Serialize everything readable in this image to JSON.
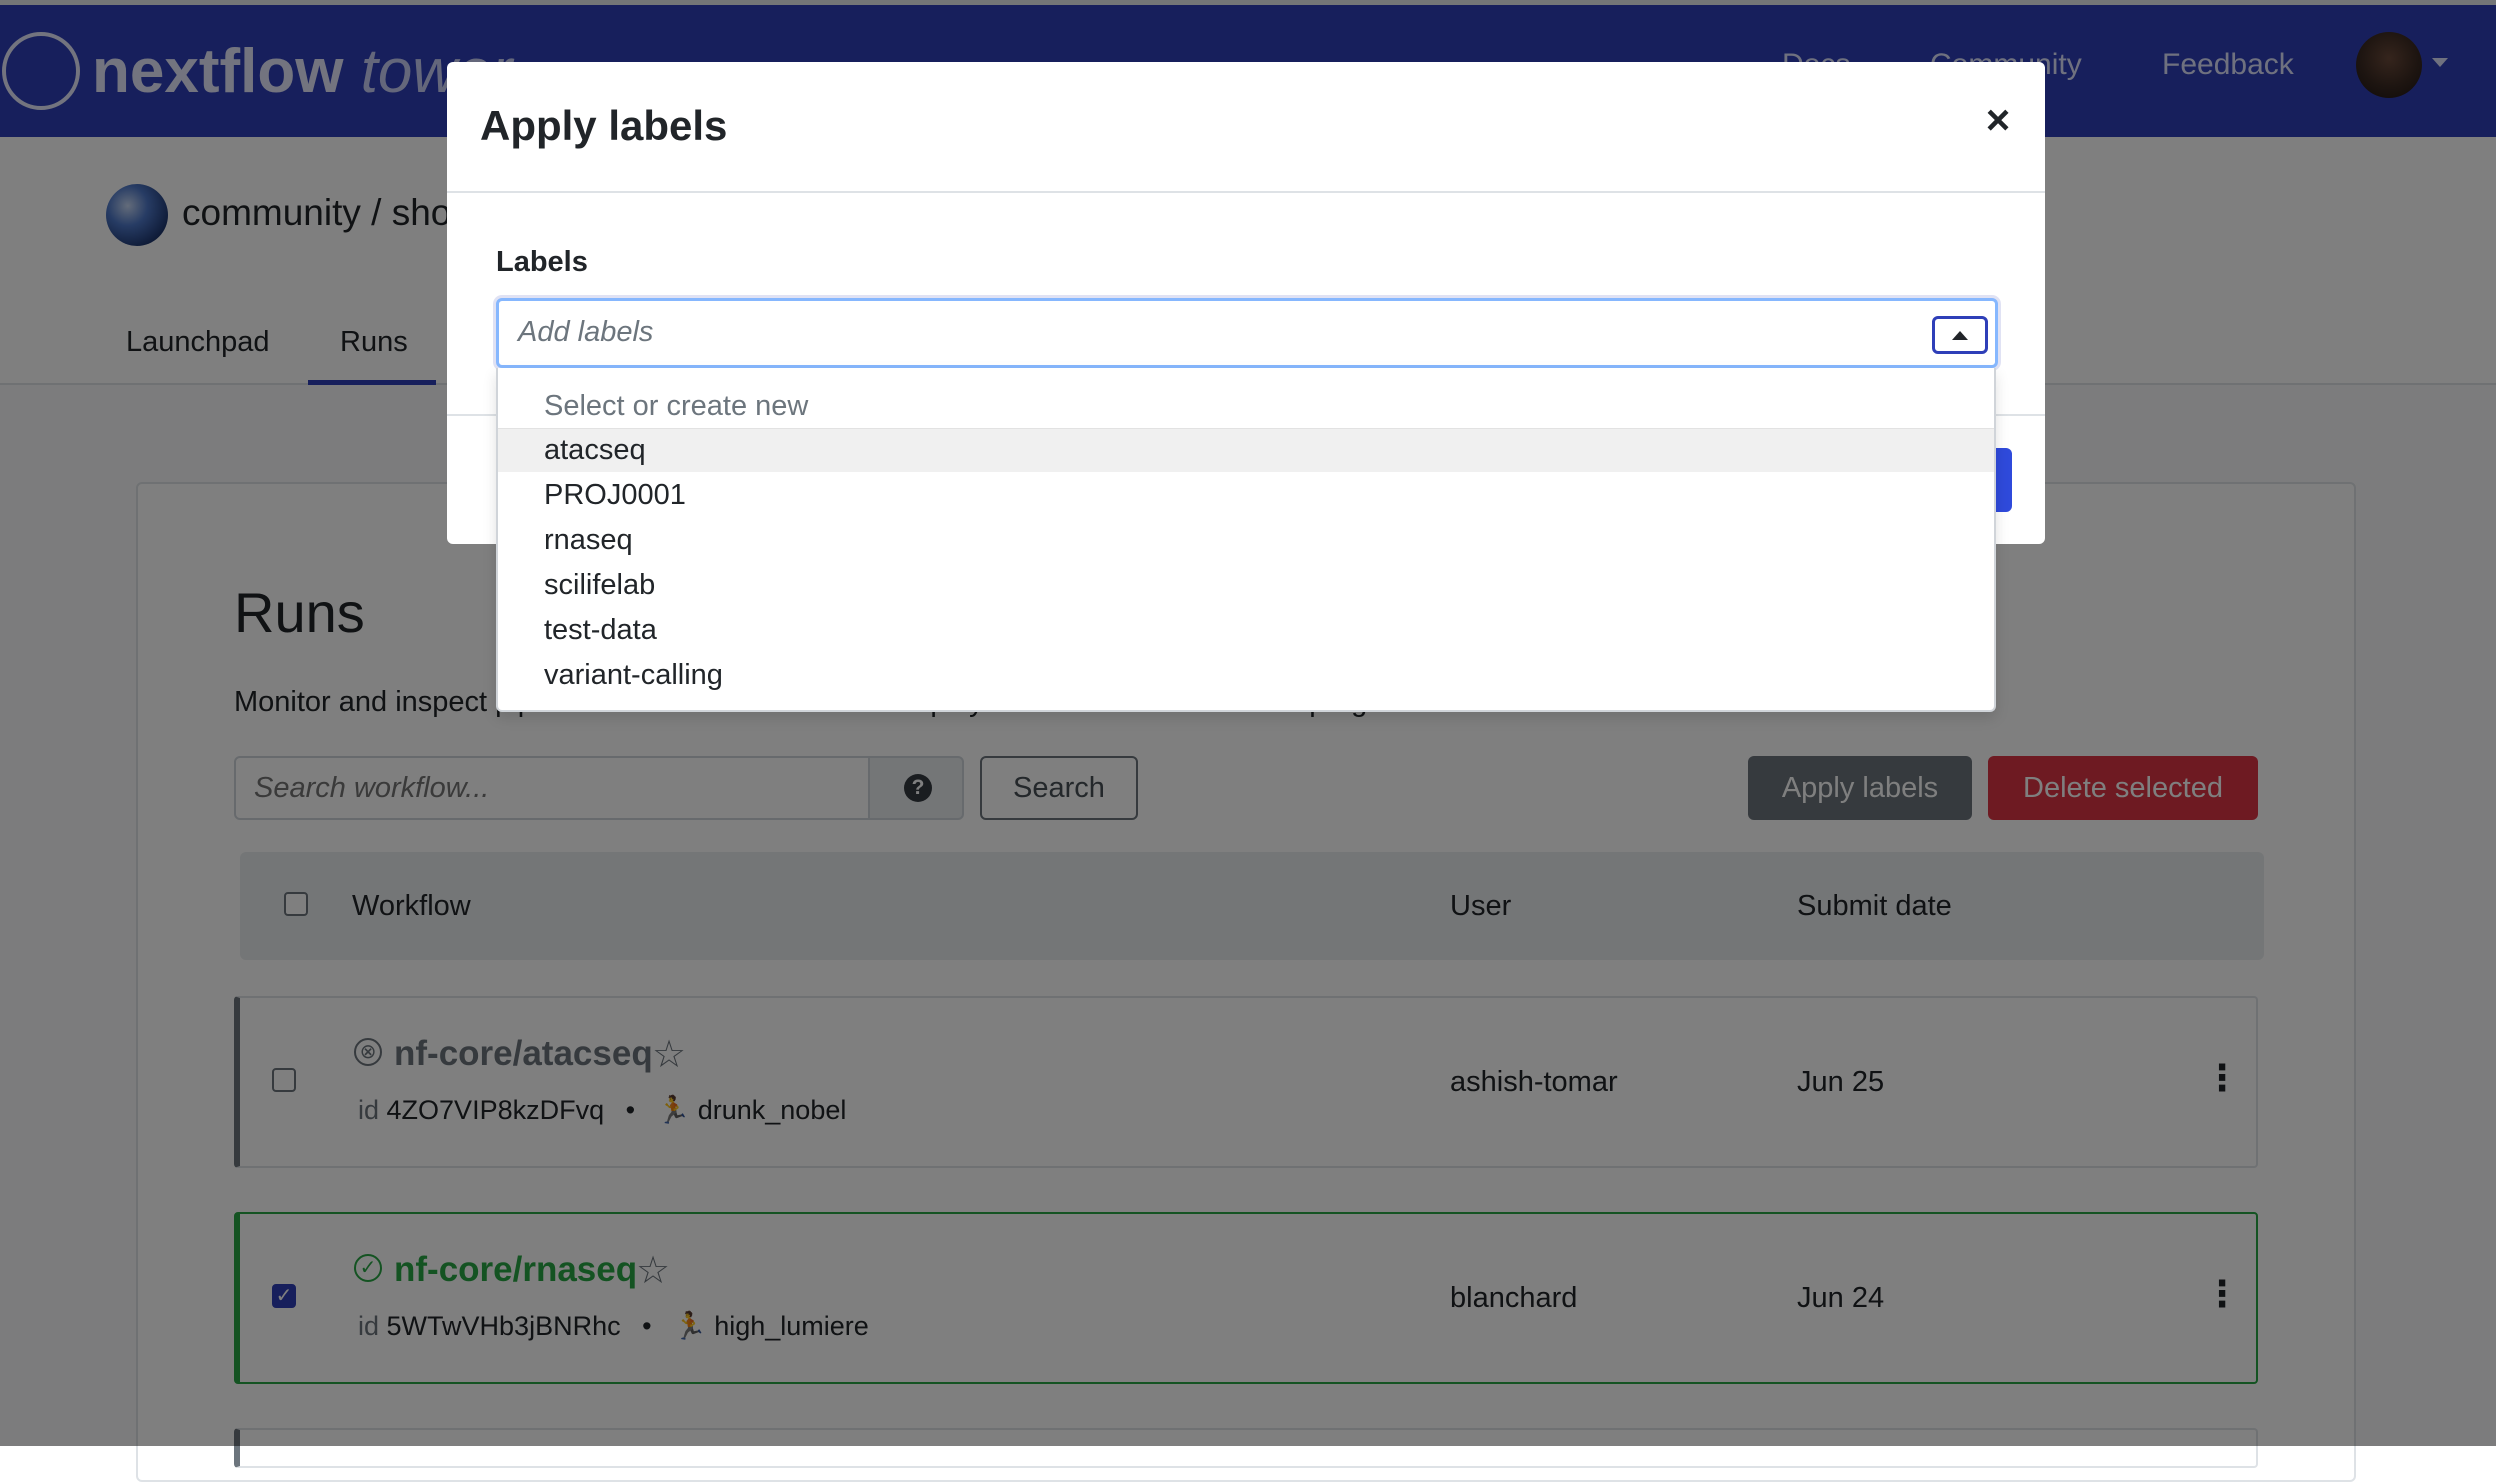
{
  "navbar": {
    "brand_main": "nextflow",
    "brand_suffix": "tower",
    "nav_links": [
      "Docs",
      "Community",
      "Feedback"
    ],
    "avatar_alt": "user-avatar"
  },
  "header": {
    "org_title": "community / showcase"
  },
  "tabs": [
    "Launchpad",
    "Runs"
  ],
  "runs_page": {
    "title": "Runs",
    "subtitle": "Monitor and inspect pipeline runs. Click on a run to display its details and execution progress.",
    "search_placeholder": "Search workflow...",
    "help_icon": "?",
    "search_button": "Search",
    "apply_labels_button": "Apply labels",
    "delete_selected_button": "Delete selected"
  },
  "table": {
    "columns": {
      "workflow": "Workflow",
      "user": "User",
      "submit_date": "Submit date"
    },
    "rows": [
      {
        "status": "failed",
        "status_icon": "⊗",
        "workflow": "nf-core/atacseq",
        "id_label": "id",
        "id": "4ZO7VIP8kzDFvq",
        "run_name": "drunk_nobel",
        "user": "ashish-tomar",
        "date": "Jun 25",
        "checked": false
      },
      {
        "status": "succeeded",
        "status_icon": "✓",
        "workflow": "nf-core/rnaseq",
        "id_label": "id",
        "id": "5WTwVHb3jBNRhc",
        "run_name": "high_lumiere",
        "user": "blanchard",
        "date": "Jun 24",
        "checked": true
      }
    ],
    "star_glyph": "☆",
    "run_glyph": "🏃",
    "bullet": "•",
    "kebab": "⋮",
    "check_glyph": "✓"
  },
  "modal": {
    "title": "Apply labels",
    "close_glyph": "×",
    "labels_heading": "Labels",
    "labels_placeholder": "Add labels",
    "dropdown_hint": "Select or create new",
    "options": [
      "atacseq",
      "PROJ0001",
      "rnaseq",
      "scilifelab",
      "test-data",
      "variant-calling"
    ]
  },
  "colors": {
    "navbar": "#2f3fb8",
    "success": "#28a745",
    "danger": "#dc3545",
    "secondary": "#6c757d"
  }
}
